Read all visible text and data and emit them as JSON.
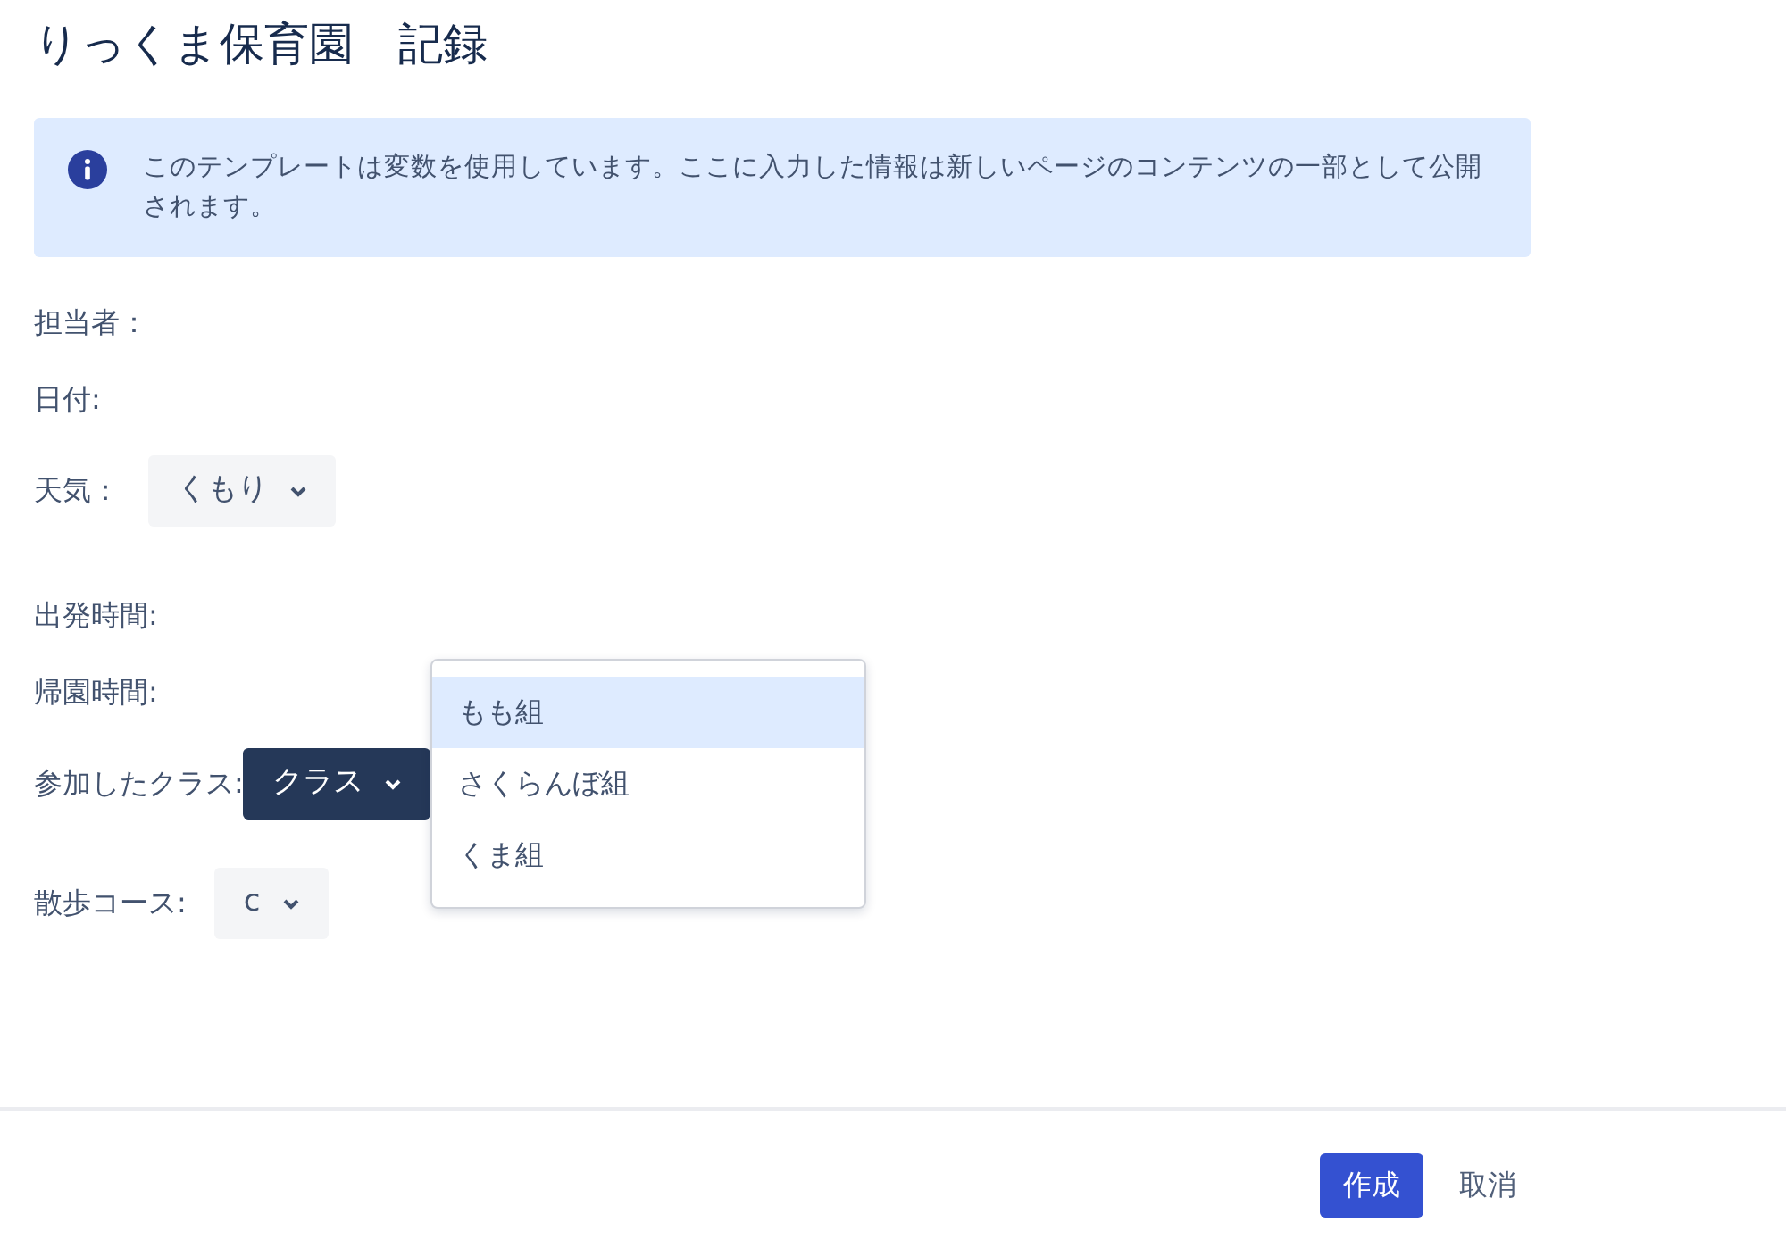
{
  "title": "りっくま保育園　記録",
  "info": {
    "text": "このテンプレートは変数を使用しています。ここに入力した情報は新しいページのコンテンツの一部として公開されます。"
  },
  "fields": [
    {
      "kind": "text",
      "label": "担当者："
    },
    {
      "kind": "text",
      "label": "日付:"
    },
    {
      "kind": "select",
      "label": "天気：",
      "value": "くもり",
      "open": false
    },
    {
      "kind": "text",
      "label": "出発時間:"
    },
    {
      "kind": "text",
      "label": "帰園時間:"
    },
    {
      "kind": "select",
      "label": "参加したクラス:",
      "value": "クラス",
      "open": true,
      "options": [
        {
          "label": "もも組",
          "selected": true
        },
        {
          "label": "さくらんぼ組",
          "selected": false
        },
        {
          "label": "くま組",
          "selected": false
        }
      ]
    },
    {
      "kind": "select",
      "label": "散歩コース:",
      "value": "c",
      "open": false
    }
  ],
  "buttons": [
    {
      "kind": "primary",
      "label": "作成"
    },
    {
      "kind": "link",
      "label": "取消"
    }
  ]
}
